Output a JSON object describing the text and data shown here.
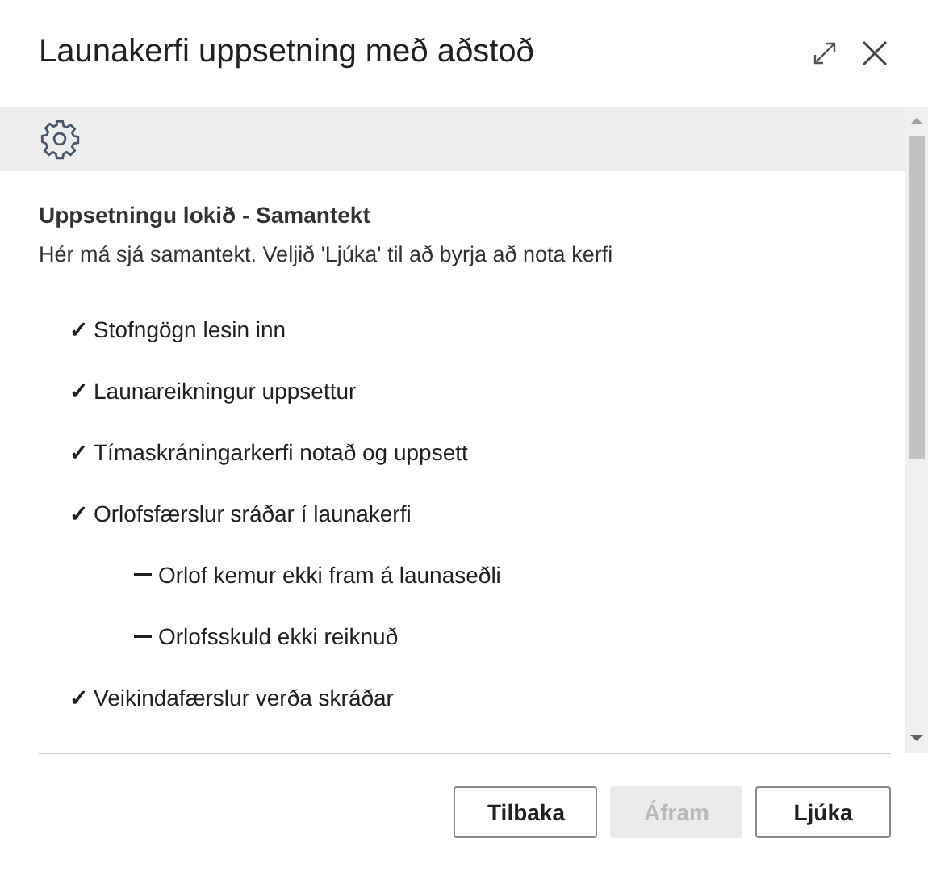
{
  "window": {
    "title": "Launakerfi uppsetning með aðstoð"
  },
  "summary": {
    "heading": "Uppsetningu lokið - Samantekt",
    "description": "Hér má sjá samantekt. Veljið 'Ljúka' til að byrja að nota kerfi"
  },
  "items": [
    {
      "kind": "check",
      "mark": "✓",
      "label": "Stofngögn lesin inn"
    },
    {
      "kind": "check",
      "mark": "✓",
      "label": "Launareikningur uppsettur"
    },
    {
      "kind": "check",
      "mark": "✓",
      "label": "Tímaskráningarkerfi notað og uppsett"
    },
    {
      "kind": "check",
      "mark": "✓",
      "label": "Orlofsfærslur sráðar í launakerfi",
      "children": [
        {
          "kind": "dash",
          "label": "Orlof kemur ekki fram á launaseðli"
        },
        {
          "kind": "dash",
          "label": "Orlofsskuld ekki reiknuð"
        }
      ]
    },
    {
      "kind": "check",
      "mark": "✓",
      "label": "Veikindafærslur verða skráðar"
    }
  ],
  "buttons": [
    {
      "label": "Tilbaka",
      "disabled": false
    },
    {
      "label": "Áfram",
      "disabled": true
    },
    {
      "label": "Ljúka",
      "disabled": false
    }
  ]
}
